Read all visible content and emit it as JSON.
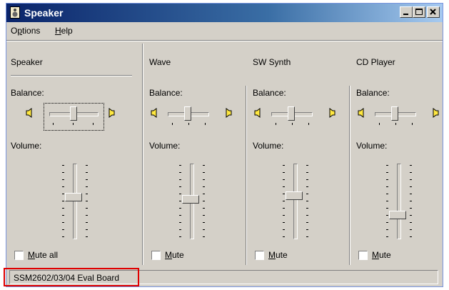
{
  "window": {
    "title": "Speaker",
    "minimize_icon": "minimize-icon",
    "maximize_icon": "maximize-icon",
    "close_icon": "close-icon"
  },
  "menu": {
    "options": "Options",
    "help": "Help"
  },
  "balance_label": "Balance:",
  "volume_label": "Volume:",
  "channels": [
    {
      "name": "Speaker",
      "mute": "Mute all",
      "balance": 0.5,
      "volume": 0.55,
      "muted": false
    },
    {
      "name": "Wave",
      "mute": "Mute",
      "balance": 0.5,
      "volume": 0.52,
      "muted": false
    },
    {
      "name": "SW Synth",
      "mute": "Mute",
      "balance": 0.5,
      "volume": 0.58,
      "muted": false
    },
    {
      "name": "CD Player",
      "mute": "Mute",
      "balance": 0.5,
      "volume": 0.28,
      "muted": false
    }
  ],
  "status": {
    "device": "SSM2602/03/04 Eval Board"
  },
  "colors": {
    "highlight": "#e00000",
    "titlebar": "#0a246a"
  }
}
